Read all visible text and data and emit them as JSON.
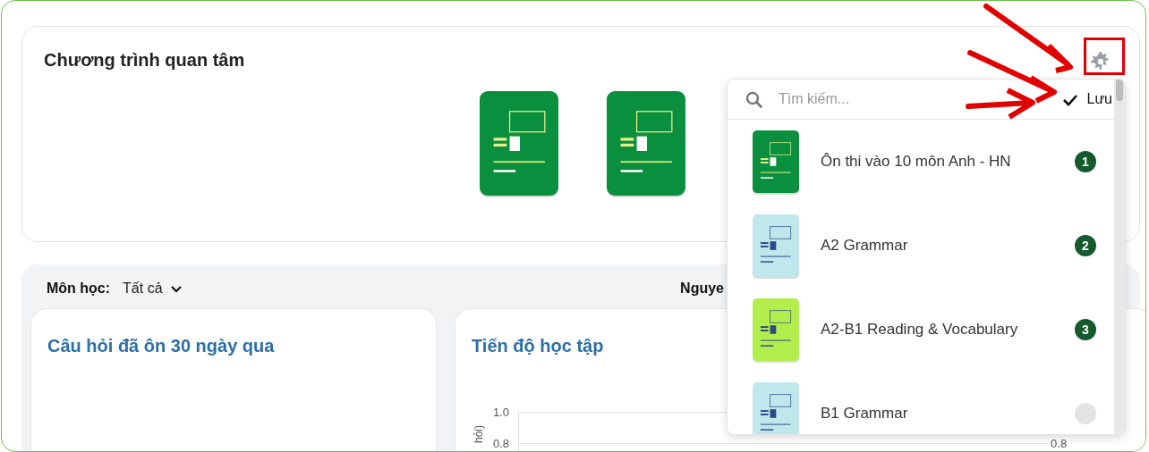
{
  "interest_card": {
    "title": "Chương trình quan tâm"
  },
  "filter": {
    "label": "Môn học:",
    "value": "Tất cả",
    "user": "Nguye"
  },
  "cards": [
    {
      "title": "Câu hỏi đã ôn 30 ngày qua",
      "kind": "empty"
    },
    {
      "title": "Tiến độ học tập",
      "kind": "chart",
      "y_label": "hỏi)",
      "y_ticks": [
        "1.0",
        "0.8"
      ],
      "right_ticks": [
        "0.8"
      ]
    }
  ],
  "dropdown": {
    "search_placeholder": "Tìm kiếm...",
    "save_label": "Lưu",
    "items": [
      {
        "title": "Ôn thi vào 10 môn Anh - HN",
        "selected": true,
        "order": "1",
        "color": "#0a8f3e"
      },
      {
        "title": "A2 Grammar",
        "selected": true,
        "order": "2",
        "color": "#bfe8ec"
      },
      {
        "title": "A2-B1 Reading & Vocabulary",
        "selected": true,
        "order": "3",
        "color": "#b3ef4c"
      },
      {
        "title": "B1 Grammar",
        "selected": false,
        "color": "#bfe8ec"
      }
    ]
  }
}
